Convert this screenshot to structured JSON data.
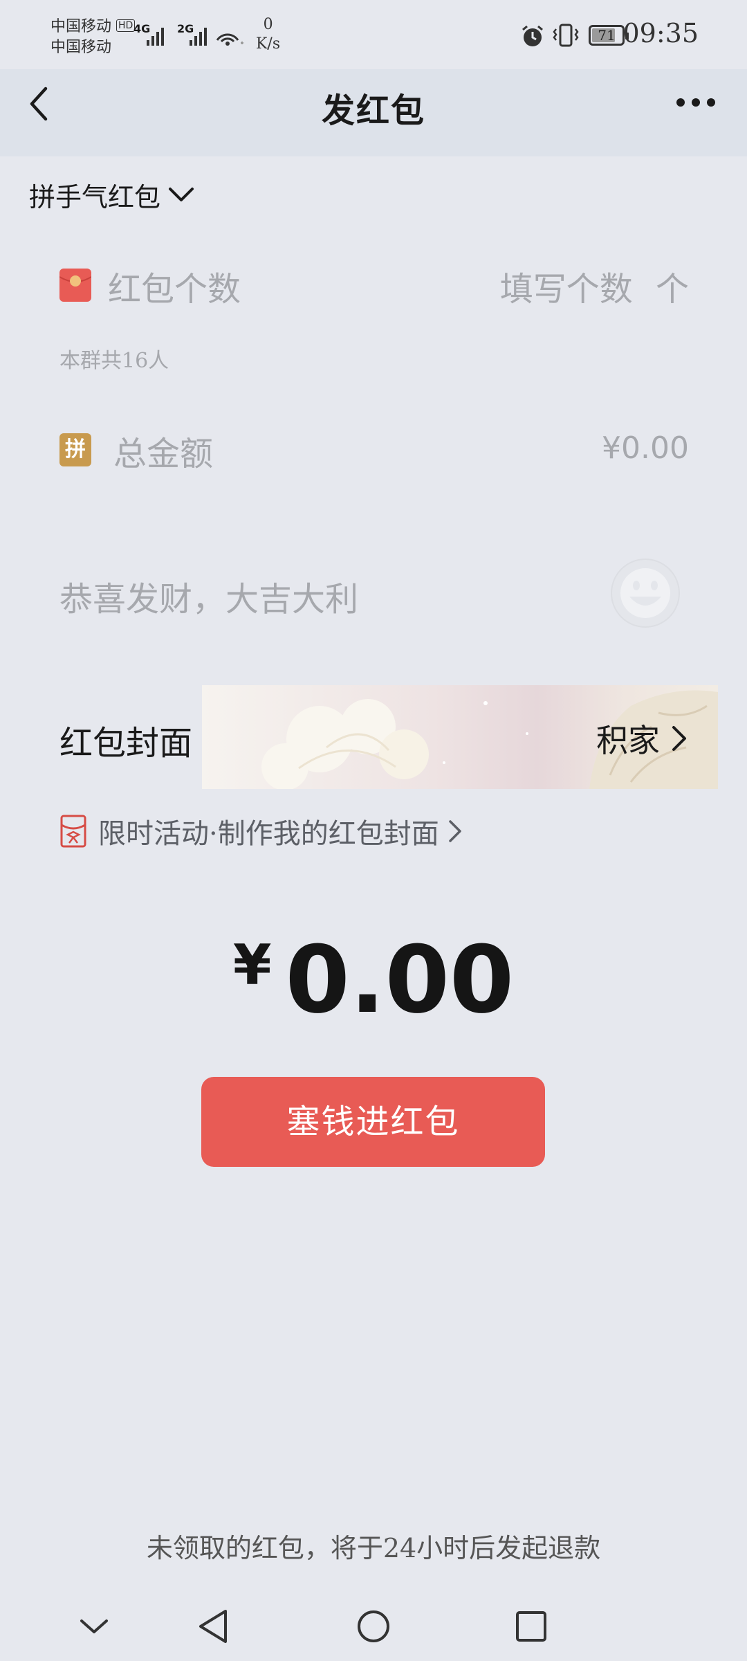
{
  "status_bar": {
    "carrier_1": "中国移动",
    "carrier_2": "中国移动",
    "hd_badge": "HD",
    "network_1": "4G",
    "network_2": "2G",
    "speed_value": "0",
    "speed_unit": "K/s",
    "battery": "71",
    "time": "09:35"
  },
  "header": {
    "title": "发红包"
  },
  "type_selector": {
    "label": "拼手气红包"
  },
  "count_row": {
    "label": "红包个数",
    "placeholder": "填写个数",
    "unit": "个",
    "hint": "本群共16人"
  },
  "amount_row": {
    "badge": "拼",
    "label": "总金额",
    "value": "¥0.00"
  },
  "greeting": {
    "placeholder": "恭喜发财，大吉大利"
  },
  "cover": {
    "label": "红包封面",
    "value": "积家"
  },
  "promo": {
    "text": "限时活动·制作我的红包封面"
  },
  "total": {
    "currency": "¥",
    "value": "0.00"
  },
  "submit": {
    "label": "塞钱进红包"
  },
  "footer": {
    "note": "未领取的红包，将于24小时后发起退款"
  },
  "colors": {
    "accent": "#e85b55",
    "page_bg": "#e6e8ee",
    "header_bg": "#dde2ea",
    "muted_text": "#a6a8ad",
    "badge_gold": "#c89a4e"
  }
}
